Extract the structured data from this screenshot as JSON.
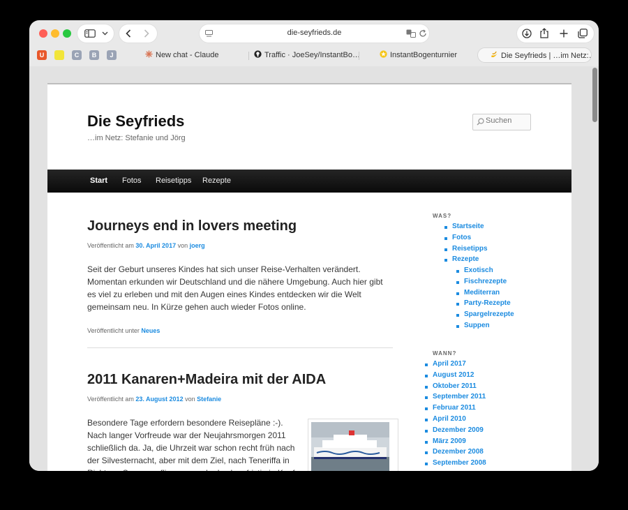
{
  "browser": {
    "url": "die-seyfrieds.de",
    "favorites": [
      {
        "letter": "U",
        "bg": "#e8572a",
        "fg": "#ffffff"
      },
      {
        "letter": "",
        "bg": "#f2e53a",
        "fg": "#000000"
      },
      {
        "letter": "C",
        "bg": "#9aa3b5",
        "fg": "#ffffff"
      },
      {
        "letter": "B",
        "bg": "#9aa3b5",
        "fg": "#ffffff"
      },
      {
        "letter": "J",
        "bg": "#9aa3b5",
        "fg": "#ffffff"
      }
    ],
    "tabs": [
      {
        "label": "New chat - Claude",
        "icon": "claude-icon"
      },
      {
        "label": "Traffic · JoeSey/InstantBo…",
        "icon": "github-icon"
      },
      {
        "label": "InstantBogenturnier",
        "icon": "star-icon"
      },
      {
        "label": "Die Seyfrieds | …im Netz:…",
        "icon": "bananas-icon"
      }
    ]
  },
  "site": {
    "title": "Die Seyfrieds",
    "description": "…im Netz: Stefanie und Jörg",
    "search_placeholder": "Suchen",
    "nav": [
      "Start",
      "Fotos",
      "Reisetipps",
      "Rezepte"
    ]
  },
  "posts": [
    {
      "title": "Journeys end in lovers meeting",
      "meta_prefix": "Veröffentlicht am ",
      "date": "30. April 2017",
      "meta_by": " von ",
      "author": "joerg",
      "body": "Seit der Geburt unseres Kindes hat sich unser Reise-Verhalten verändert. Momentan erkunden wir Deutschland und die nähere Umgebung. Auch hier gibt es viel zu erleben und mit den Augen eines Kindes entdecken wir die Welt gemeinsam neu. In Kürze gehen auch wieder Fotos online.",
      "footer_prefix": "Veröffentlicht unter ",
      "category": "Neues"
    },
    {
      "title": "2011 Kanaren+Madeira mit der AIDA",
      "meta_prefix": "Veröffentlicht am ",
      "date": "23. August 2012",
      "meta_by": " von ",
      "author": "Stefanie",
      "body": "Besondere Tage erfordern besondere Reisepläne :-). Nach langer Vorfreude war der Neujahrsmorgen 2011 schließlich da. Ja, die Uhrzeit war schon recht früh nach der Silvesternacht, aber mit dem Ziel, nach Teneriffa in Richtung Sonne zu fliegen, wurde das kurzfristig in Kauf genommen."
    }
  ],
  "sidebar": {
    "was_title": "WAS?",
    "was_items": [
      "Startseite",
      "Fotos",
      "Reisetipps",
      "Rezepte"
    ],
    "rezepte_sub": [
      "Exotisch",
      "Fischrezepte",
      "Mediterran",
      "Party-Rezepte",
      "Spargelrezepte",
      "Suppen"
    ],
    "wann_title": "WANN?",
    "wann_items": [
      "April 2017",
      "August 2012",
      "Oktober 2011",
      "September 2011",
      "Februar 2011",
      "April 2010",
      "Dezember 2009",
      "März 2009",
      "Dezember 2008",
      "September 2008"
    ]
  }
}
